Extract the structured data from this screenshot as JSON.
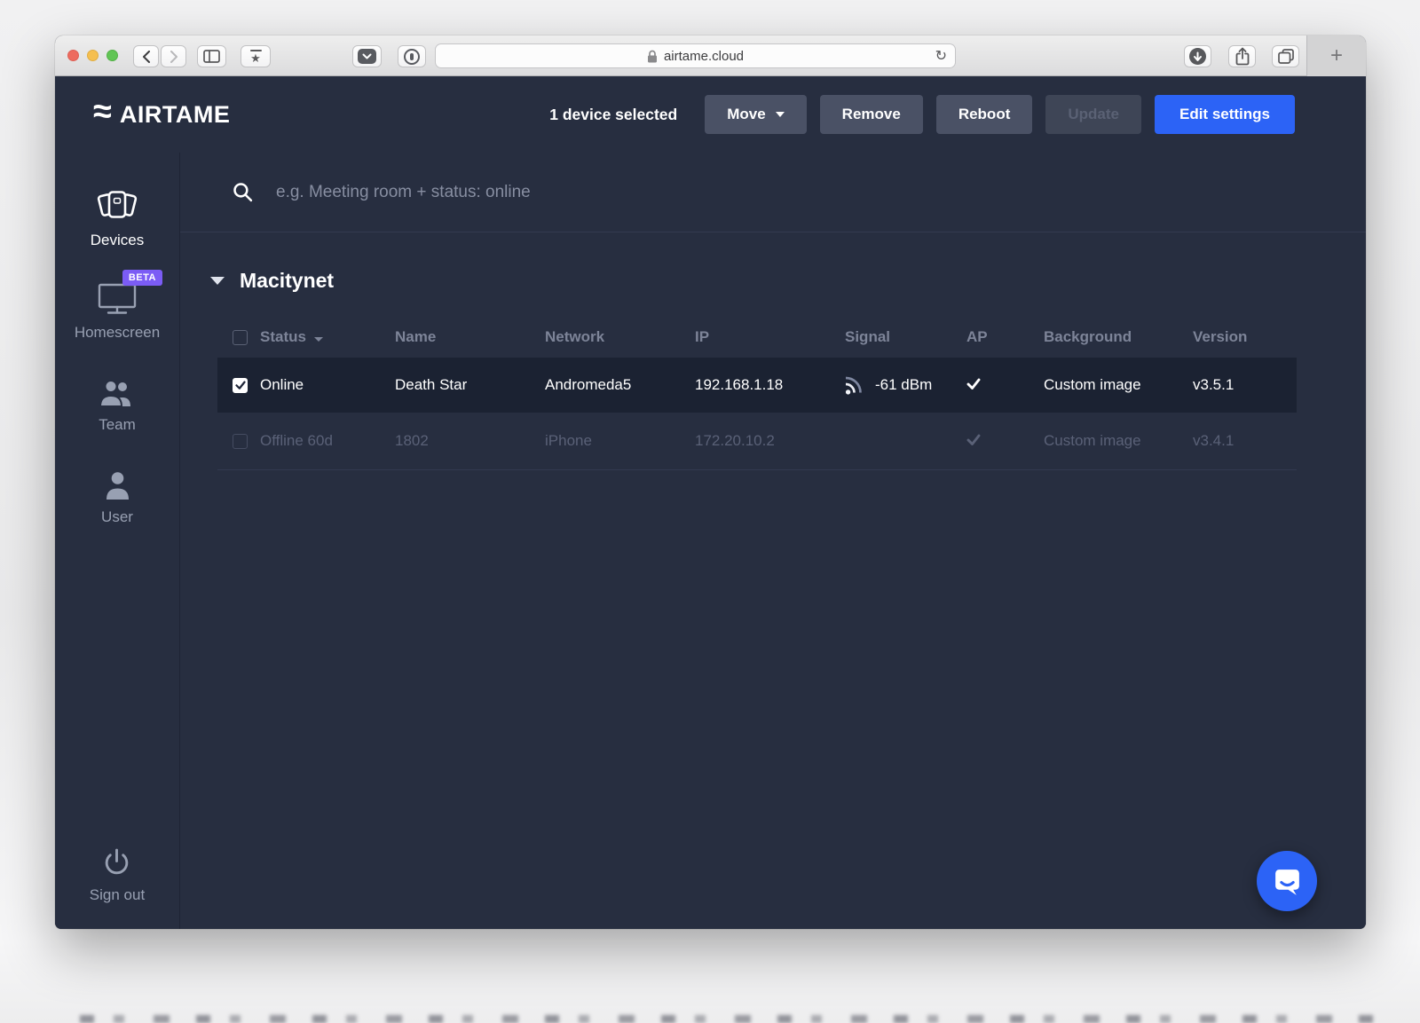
{
  "browser": {
    "url": "airtame.cloud",
    "new_tab": "+"
  },
  "header": {
    "logo": "AIRTAME",
    "selection": "1 device selected",
    "move": "Move",
    "remove": "Remove",
    "reboot": "Reboot",
    "update": "Update",
    "edit_settings": "Edit settings"
  },
  "sidebar": {
    "devices": "Devices",
    "homescreen": "Homescreen",
    "beta": "BETA",
    "team": "Team",
    "user": "User",
    "signout": "Sign out"
  },
  "main": {
    "search_placeholder": "e.g. Meeting room + status: online",
    "group": "Macitynet"
  },
  "table": {
    "h": {
      "status": "Status",
      "name": "Name",
      "network": "Network",
      "ip": "IP",
      "signal": "Signal",
      "ap": "AP",
      "background": "Background",
      "version": "Version"
    },
    "rows": [
      {
        "status": "Online",
        "name": "Death Star",
        "network": "Andromeda5",
        "ip": "192.168.1.18",
        "signal": "-61 dBm",
        "background": "Custom image",
        "version": "v3.5.1",
        "selected": true,
        "ap": true
      },
      {
        "status": "Offline 60d",
        "name": "1802",
        "network": "iPhone",
        "ip": "172.20.10.2",
        "signal": "",
        "background": "Custom image",
        "version": "v3.4.1",
        "selected": false,
        "ap": true
      }
    ]
  },
  "colors": {
    "accent_blue": "#2c63f6",
    "beta_purple": "#7b5cf5",
    "bg_navy": "#272e40",
    "selected_row": "#1b2232"
  }
}
